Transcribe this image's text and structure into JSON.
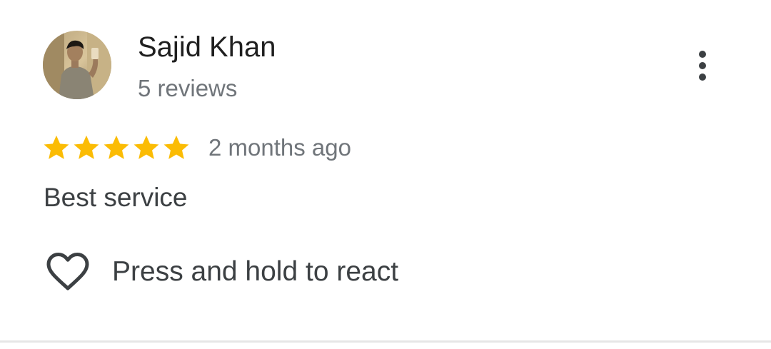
{
  "review": {
    "author_name": "Sajid Khan",
    "review_count": "5 reviews",
    "rating": 5,
    "rating_max": 5,
    "date": "2 months ago",
    "text": "Best service",
    "react_label": "Press and hold to react"
  },
  "colors": {
    "star": "#FBBC04",
    "name": "#1f1f1f",
    "secondary_text": "#70757a",
    "body_text": "#3c4043",
    "divider": "#e6e6e6"
  },
  "icons": {
    "avatar": "user-avatar-photo",
    "more": "more-vert-icon",
    "star": "star-icon",
    "react": "heart-outline-icon"
  }
}
